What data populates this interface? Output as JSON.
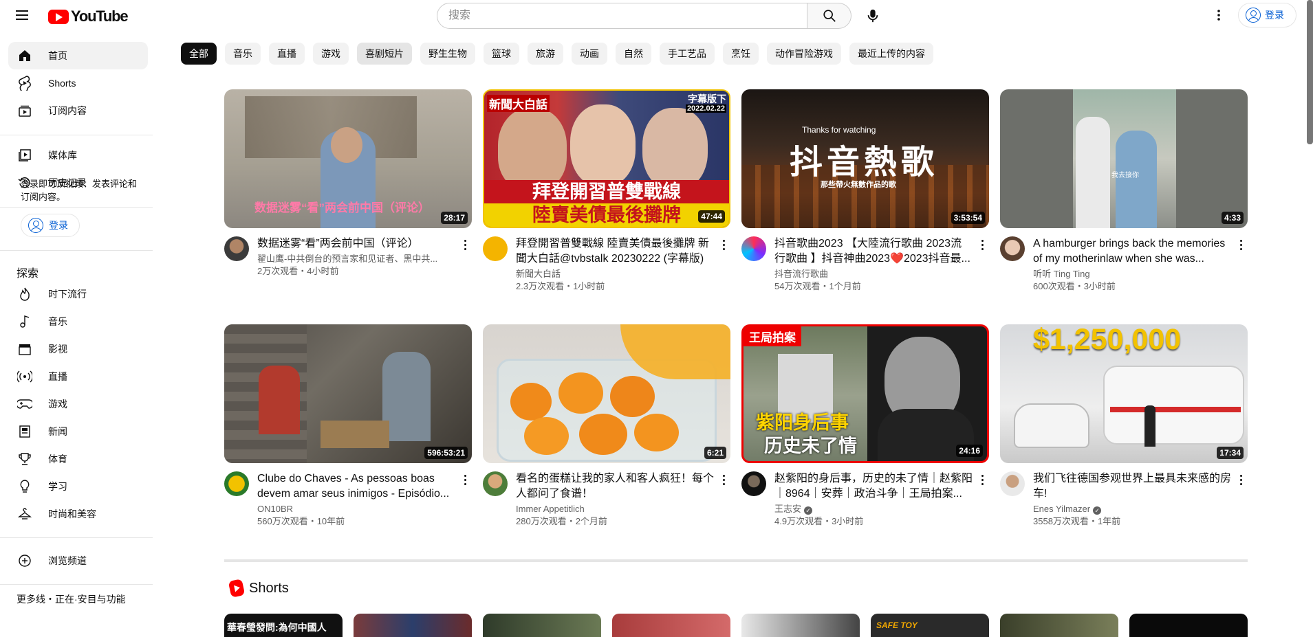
{
  "header": {
    "logo_text": "YouTube",
    "search_placeholder": "搜索",
    "signin_label": "登录"
  },
  "sidebar": {
    "main": [
      {
        "label": "首页",
        "icon": "home-icon"
      },
      {
        "label": "Shorts",
        "icon": "shorts-icon"
      },
      {
        "label": "订阅内容",
        "icon": "subscriptions-icon"
      }
    ],
    "library": [
      {
        "label": "媒体库",
        "icon": "library-icon"
      },
      {
        "label": "历史记录",
        "icon": "history-icon"
      }
    ],
    "signin_note": "登录即可顶视频、发表评论和订阅内容。",
    "signin_label": "登录",
    "explore_title": "探索",
    "explore": [
      {
        "label": "时下流行",
        "icon": "trending-icon"
      },
      {
        "label": "音乐",
        "icon": "music-icon"
      },
      {
        "label": "影视",
        "icon": "movies-icon"
      },
      {
        "label": "直播",
        "icon": "live-icon"
      },
      {
        "label": "游戏",
        "icon": "gaming-icon"
      },
      {
        "label": "新闻",
        "icon": "news-icon"
      },
      {
        "label": "体育",
        "icon": "sports-icon"
      },
      {
        "label": "学习",
        "icon": "learning-icon"
      },
      {
        "label": "时尚和美容",
        "icon": "fashion-icon"
      }
    ],
    "browse_channels": "浏览频道",
    "bottom_partial": "更多线・正在·安目与功能"
  },
  "chips": [
    "全部",
    "音乐",
    "直播",
    "游戏",
    "喜剧短片",
    "野生生物",
    "篮球",
    "旅游",
    "动画",
    "自然",
    "手工艺品",
    "烹饪",
    "动作冒险游戏",
    "最近上传的内容"
  ],
  "videos": [
    {
      "title": "数据迷雾“看”两会前中国（评论）",
      "channel": "翟山鹰-中共倒台的预言家和见证者、黑中共...",
      "stats": "2万次观看・4小时前",
      "duration": "28:17",
      "thumb_text": "数据迷雾“看”两会前中国（评论）",
      "verified": false
    },
    {
      "title": "拜登開習普雙戰線 陸賣美債最後攤牌 新聞大白話@tvbstalk 20230222 (字幕版)",
      "channel": "新聞大白話",
      "stats": "2.3万次观看・1小时前",
      "duration": "47:44",
      "thumb_text": "拜登開習普雙戰線",
      "thumb_text2": "陸賣美債最後攤牌",
      "thumb_tag": "字幕版下",
      "thumb_date": "2022.02.22",
      "thumb_logo": "新聞大白話",
      "verified": false
    },
    {
      "title": "抖音歌曲2023 【大陸流行歌曲 2023流行歌曲 】抖音神曲2023❤️2023抖音最...",
      "channel": "抖音流行歌曲",
      "stats": "54万次观看・1个月前",
      "duration": "3:53:54",
      "thumb_text": "抖音熱歌",
      "thumb_sub": "那些帶火無數作品的歌",
      "thumb_top": "Thanks for watching",
      "verified": false
    },
    {
      "title": "A hamburger brings back the memories of my motherinlaw when she was...",
      "channel": "听听 Ting Ting",
      "stats": "600次观看・3小时前",
      "duration": "4:33",
      "thumb_text": "我去接你",
      "verified": false
    },
    {
      "title": "Clube do Chaves - As pessoas boas devem amar seus inimigos - Episódio...",
      "channel": "ON10BR",
      "stats": "560万次观看・10年前",
      "duration": "596:53:21",
      "verified": false
    },
    {
      "title": "看名的蛋糕让我的家人和客人疯狂！每个人都问了食谱！",
      "channel": "Immer Appetitlich",
      "stats": "280万次观看・2个月前",
      "duration": "6:21",
      "verified": false
    },
    {
      "title": "赵紫阳的身后事，历史的未了情｜赵紫阳｜8964｜安葬｜政治斗争｜王局拍案...",
      "channel": "王志安",
      "stats": "4.9万次观看・3小时前",
      "duration": "24:16",
      "thumb_tag": "王局拍案",
      "thumb_text": "紫阳身后事",
      "thumb_text2": "历史未了情",
      "verified": true
    },
    {
      "title": "我们飞往德国参观世界上最具未来感的房车!",
      "channel": "Enes Yilmazer",
      "stats": "3558万次观看・1年前",
      "duration": "17:34",
      "thumb_text": "$1,250,000",
      "verified": true
    }
  ],
  "shorts": {
    "title": "Shorts",
    "first_caption": "華春瑩發問:為何中國人",
    "sixth_caption": "SAFE TOY"
  },
  "colors": {
    "brand_red": "#ff0000",
    "link_blue": "#065fd4",
    "chip_active": "#0f0f0f",
    "chip_bg": "#f2f2f2",
    "secondary_text": "#606060"
  }
}
